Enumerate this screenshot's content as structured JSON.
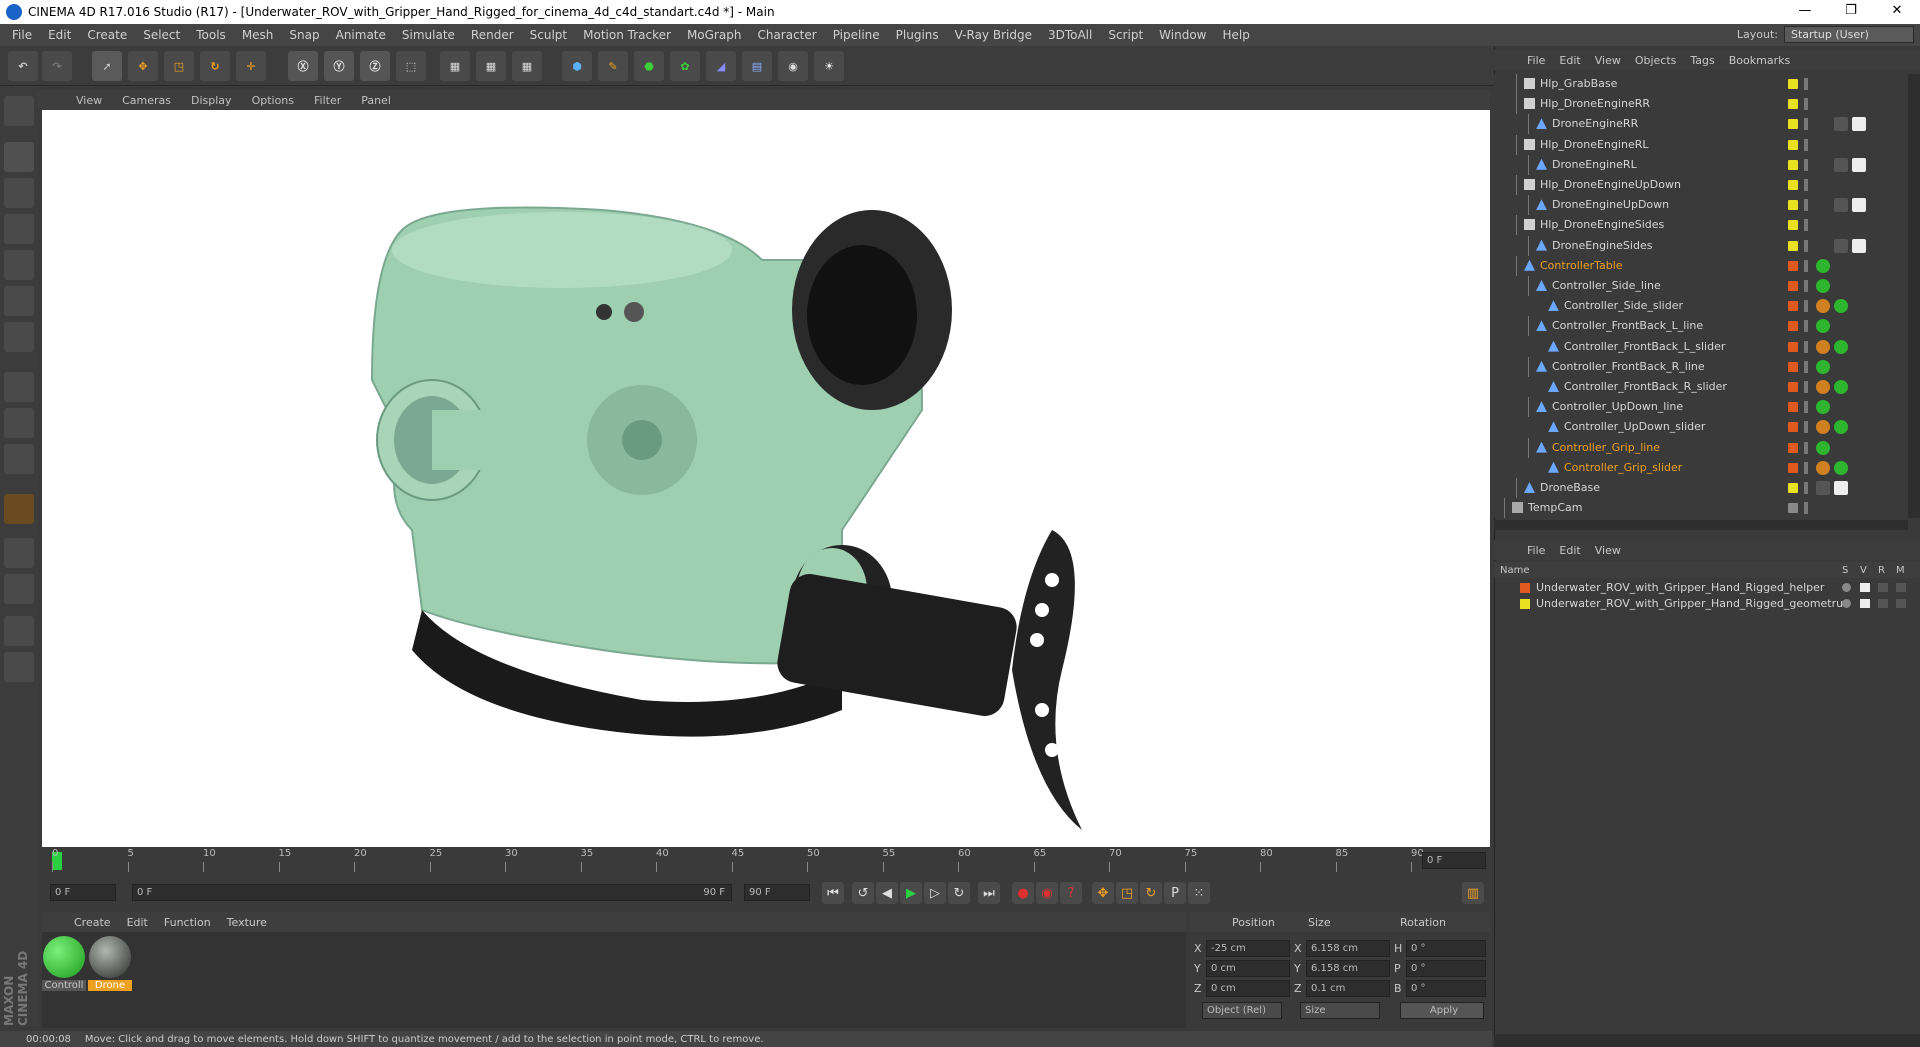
{
  "window": {
    "title": "CINEMA 4D R17.016 Studio (R17) - [Underwater_ROV_with_Gripper_Hand_Rigged_for_cinema_4d_c4d_standart.c4d *] - Main",
    "controls": [
      "—",
      "❐",
      "✕"
    ]
  },
  "menubar": {
    "items": [
      "File",
      "Edit",
      "Create",
      "Select",
      "Tools",
      "Mesh",
      "Snap",
      "Animate",
      "Simulate",
      "Render",
      "Sculpt",
      "Motion Tracker",
      "MoGraph",
      "Character",
      "Pipeline",
      "Plugins",
      "V-Ray Bridge",
      "3DToAll",
      "Script",
      "Window",
      "Help"
    ],
    "layout_label": "Layout:",
    "layout_value": "Startup (User)"
  },
  "viewport": {
    "menu": [
      "View",
      "Cameras",
      "Display",
      "Options",
      "Filter",
      "Panel"
    ]
  },
  "timeline": {
    "ticks": [
      "0",
      "5",
      "10",
      "15",
      "20",
      "25",
      "30",
      "35",
      "40",
      "45",
      "50",
      "55",
      "60",
      "65",
      "70",
      "75",
      "80",
      "85",
      "90"
    ],
    "current_frame_field": "0 F",
    "start_field": "0 F",
    "range_start": "0 F",
    "range_end": "90 F",
    "end_field": "90 F"
  },
  "materials": {
    "menu": [
      "Create",
      "Edit",
      "Function",
      "Texture"
    ],
    "items": [
      {
        "label": "Controll",
        "color": "#2db52d"
      },
      {
        "label": "Drone",
        "color": "#6a7a6a"
      }
    ]
  },
  "coords": {
    "headers": [
      "Position",
      "Size",
      "Rotation"
    ],
    "rows": [
      {
        "axis": "X",
        "pos": "-25 cm",
        "size_axis": "X",
        "size": "6.158 cm",
        "rot_axis": "H",
        "rot": "0 °"
      },
      {
        "axis": "Y",
        "pos": "0 cm",
        "size_axis": "Y",
        "size": "6.158 cm",
        "rot_axis": "P",
        "rot": "0 °"
      },
      {
        "axis": "Z",
        "pos": "0 cm",
        "size_axis": "Z",
        "size": "0.1 cm",
        "rot_axis": "B",
        "rot": "0 °"
      }
    ],
    "mode": "Object (Rel)",
    "size_mode": "Size",
    "apply": "Apply"
  },
  "status": {
    "time": "00:00:08",
    "message": "Move: Click and drag to move elements. Hold down SHIFT to quantize movement / add to the selection in point mode, CTRL to remove."
  },
  "object_manager": {
    "menu": [
      "File",
      "Edit",
      "View",
      "Objects",
      "Tags",
      "Bookmarks"
    ],
    "rows": [
      {
        "name": "Hlp_GrabBase",
        "indent": 2,
        "type": "null",
        "color": "#e8e020",
        "highlight": false
      },
      {
        "name": "Hlp_DroneEngineRR",
        "indent": 2,
        "type": "null",
        "color": "#e8e020",
        "highlight": false
      },
      {
        "name": "DroneEngineRR",
        "indent": 3,
        "type": "mesh",
        "color": "#e8e020",
        "highlight": false
      },
      {
        "name": "Hlp_DroneEngineRL",
        "indent": 2,
        "type": "null",
        "color": "#e8e020",
        "highlight": false
      },
      {
        "name": "DroneEngineRL",
        "indent": 3,
        "type": "mesh",
        "color": "#e8e020",
        "highlight": false
      },
      {
        "name": "Hlp_DroneEngineUpDown",
        "indent": 2,
        "type": "null",
        "color": "#e8e020",
        "highlight": false
      },
      {
        "name": "DroneEngineUpDown",
        "indent": 3,
        "type": "mesh",
        "color": "#e8e020",
        "highlight": false
      },
      {
        "name": "Hlp_DroneEngineSides",
        "indent": 2,
        "type": "null",
        "color": "#e8e020",
        "highlight": false
      },
      {
        "name": "DroneEngineSides",
        "indent": 3,
        "type": "mesh",
        "color": "#e8e020",
        "highlight": false
      },
      {
        "name": "ControllerTable",
        "indent": 2,
        "type": "mesh",
        "color": "#e05a20",
        "highlight": true
      },
      {
        "name": "Controller_Side_line",
        "indent": 3,
        "type": "mesh",
        "color": "#e05a20",
        "highlight": false
      },
      {
        "name": "Controller_Side_slider",
        "indent": 4,
        "type": "mesh",
        "color": "#e05a20",
        "highlight": false
      },
      {
        "name": "Controller_FrontBack_L_line",
        "indent": 3,
        "type": "mesh",
        "color": "#e05a20",
        "highlight": false
      },
      {
        "name": "Controller_FrontBack_L_slider",
        "indent": 4,
        "type": "mesh",
        "color": "#e05a20",
        "highlight": false
      },
      {
        "name": "Controller_FrontBack_R_line",
        "indent": 3,
        "type": "mesh",
        "color": "#e05a20",
        "highlight": false
      },
      {
        "name": "Controller_FrontBack_R_slider",
        "indent": 4,
        "type": "mesh",
        "color": "#e05a20",
        "highlight": false
      },
      {
        "name": "Controller_UpDown_line",
        "indent": 3,
        "type": "mesh",
        "color": "#e05a20",
        "highlight": false
      },
      {
        "name": "Controller_UpDown_slider",
        "indent": 4,
        "type": "mesh",
        "color": "#e05a20",
        "highlight": false
      },
      {
        "name": "Controller_Grip_line",
        "indent": 3,
        "type": "mesh",
        "color": "#e05a20",
        "highlight": true
      },
      {
        "name": "Controller_Grip_slider",
        "indent": 4,
        "type": "mesh",
        "color": "#e05a20",
        "highlight": true
      },
      {
        "name": "DroneBase",
        "indent": 2,
        "type": "mesh",
        "color": "#e8e020",
        "highlight": false
      },
      {
        "name": "TempCam",
        "indent": 1,
        "type": "camera",
        "color": "#888888",
        "highlight": false
      }
    ]
  },
  "layer_manager": {
    "menu": [
      "File",
      "Edit",
      "View"
    ],
    "header_name": "Name",
    "header_cols": [
      "S",
      "V",
      "R",
      "M"
    ],
    "rows": [
      {
        "name": "Underwater_ROV_with_Gripper_Hand_Rigged_helper",
        "color": "#e05a20"
      },
      {
        "name": "Underwater_ROV_with_Gripper_Hand_Rigged_geometru",
        "color": "#e8e020"
      }
    ]
  },
  "branding": "MAXON CINEMA 4D",
  "colors": {
    "accent_orange": "#f0a020",
    "timeline_marker": "#2ad040",
    "highlight_text": "#f0a020"
  }
}
